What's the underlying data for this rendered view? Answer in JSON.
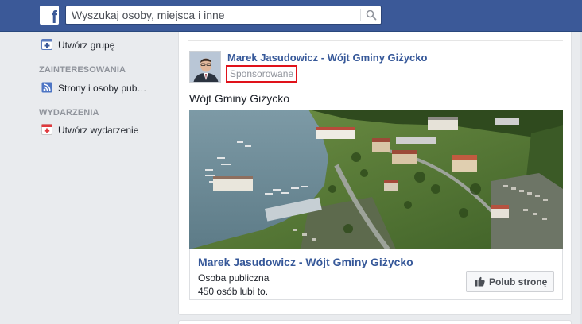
{
  "header": {
    "logo": "f",
    "search_placeholder": "Wyszukaj osoby, miejsca i inne",
    "search_icon": "search-icon"
  },
  "sidebar": {
    "items": [
      {
        "label": "Utwórz grupę",
        "icon": "plus-square-icon"
      },
      {
        "label": "Strony i osoby pub…",
        "icon": "rss-feed-icon"
      },
      {
        "label": "Utwórz wydarzenie",
        "icon": "calendar-plus-icon"
      }
    ],
    "sections": [
      "ZAINTERESOWANIA",
      "WYDARZENIA"
    ]
  },
  "post": {
    "author": "Marek Jasudowicz - Wójt Gminy Giżycko",
    "sponsored": "Sponsorowane",
    "text": "Wójt Gminy Giżycko",
    "attachment": {
      "title": "Marek Jasudowicz - Wójt Gminy Giżycko",
      "category": "Osoba publiczna",
      "likes": "450 osób lubi to.",
      "like_button": "Polub stronę"
    }
  },
  "colors": {
    "brand": "#3b5998",
    "link": "#365899",
    "highlight_border": "#e0121a",
    "background": "#e9ebee"
  }
}
